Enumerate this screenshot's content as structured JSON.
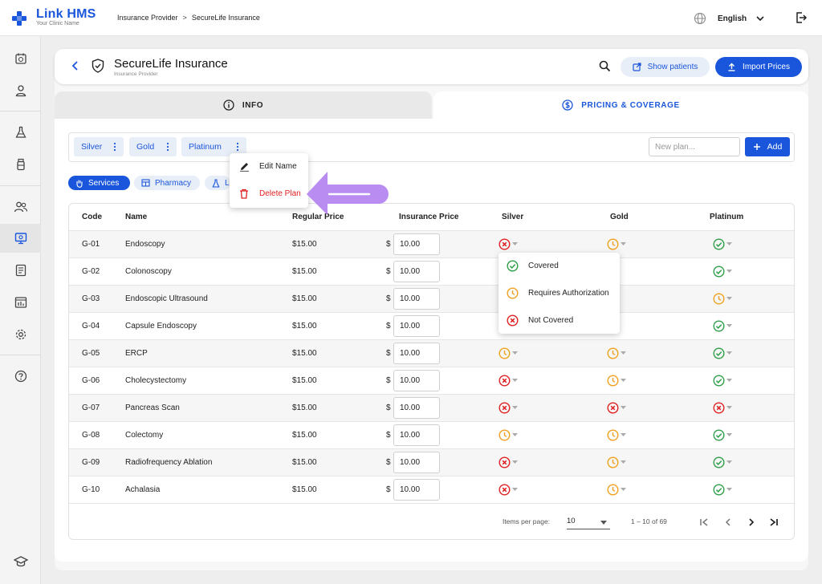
{
  "app": {
    "name": "Link HMS",
    "subtitle": "Your Clinic Name",
    "brand_color": "#1a56db"
  },
  "breadcrumb": [
    "Insurance Provider",
    "SecureLife Insurance"
  ],
  "breadcrumb_separator": ">",
  "language": "English",
  "sidebar": {
    "items": [
      "appointments-icon",
      "patient-icon",
      "lab-icon",
      "pharmacy-icon",
      "staff-icon",
      "insurance-icon",
      "billing-icon",
      "reports-icon",
      "settings-icon",
      "help-icon",
      "graduation-icon"
    ],
    "active": "insurance-icon"
  },
  "header": {
    "title": "SecureLife Insurance",
    "subtitle": "Insurance Provider",
    "show_patients": "Show patients",
    "import_prices": "Import Prices"
  },
  "tabs": [
    {
      "label": "INFO"
    },
    {
      "label": "PRICING & COVERAGE",
      "active": true
    }
  ],
  "plans": {
    "items": [
      "Silver",
      "Gold",
      "Platinum"
    ],
    "new_plan_placeholder": "New plan...",
    "add_label": "Add"
  },
  "plan_menu": {
    "items": [
      "Edit Name",
      "Delete Plan"
    ]
  },
  "categories": [
    {
      "label": "Services",
      "active": true
    },
    {
      "label": "Pharmacy",
      "active": false
    },
    {
      "label": "L",
      "active": false
    }
  ],
  "table": {
    "columns": [
      "Code",
      "Name",
      "Regular Price",
      "Insurance Price",
      "Silver",
      "Gold",
      "Platinum"
    ],
    "currency_symbol": "$",
    "rows": [
      {
        "code": "G-01",
        "name": "Endoscopy",
        "regular": "$15.00",
        "insurance": "10.00",
        "silver": "not-covered",
        "gold": "requires-authorization",
        "platinum": "covered"
      },
      {
        "code": "G-02",
        "name": "Colonoscopy",
        "regular": "$15.00",
        "insurance": "10.00",
        "silver": "",
        "gold": "",
        "platinum": "covered"
      },
      {
        "code": "G-03",
        "name": "Endoscopic Ultrasound",
        "regular": "$15.00",
        "insurance": "10.00",
        "silver": "",
        "gold": "",
        "platinum": "requires-authorization"
      },
      {
        "code": "G-04",
        "name": "Capsule Endoscopy",
        "regular": "$15.00",
        "insurance": "10.00",
        "silver": "",
        "gold": "",
        "platinum": "covered"
      },
      {
        "code": "G-05",
        "name": "ERCP",
        "regular": "$15.00",
        "insurance": "10.00",
        "silver": "requires-authorization",
        "gold": "requires-authorization",
        "platinum": "covered"
      },
      {
        "code": "G-06",
        "name": "Cholecystectomy",
        "regular": "$15.00",
        "insurance": "10.00",
        "silver": "not-covered",
        "gold": "requires-authorization",
        "platinum": "covered"
      },
      {
        "code": "G-07",
        "name": "Pancreas Scan",
        "regular": "$15.00",
        "insurance": "10.00",
        "silver": "not-covered",
        "gold": "not-covered",
        "platinum": "not-covered"
      },
      {
        "code": "G-08",
        "name": "Colectomy",
        "regular": "$15.00",
        "insurance": "10.00",
        "silver": "requires-authorization",
        "gold": "requires-authorization",
        "platinum": "covered"
      },
      {
        "code": "G-09",
        "name": "Radiofrequency Ablation",
        "regular": "$15.00",
        "insurance": "10.00",
        "silver": "not-covered",
        "gold": "requires-authorization",
        "platinum": "covered"
      },
      {
        "code": "G-10",
        "name": "Achalasia",
        "regular": "$15.00",
        "insurance": "10.00",
        "silver": "not-covered",
        "gold": "requires-authorization",
        "platinum": "covered"
      }
    ]
  },
  "status_dropdown": {
    "items": [
      {
        "label": "Covered",
        "status": "covered"
      },
      {
        "label": "Requires Authorization",
        "status": "requires-authorization"
      },
      {
        "label": "Not Covered",
        "status": "not-covered"
      }
    ]
  },
  "status_colors": {
    "covered": "#2e9e47",
    "requires-authorization": "#f0a020",
    "not-covered": "#e02020"
  },
  "pagination": {
    "items_per_page_label": "Items per page:",
    "items_per_page": "10",
    "range": "1 – 10 of 69"
  },
  "annotation_color": "#b88cf0"
}
